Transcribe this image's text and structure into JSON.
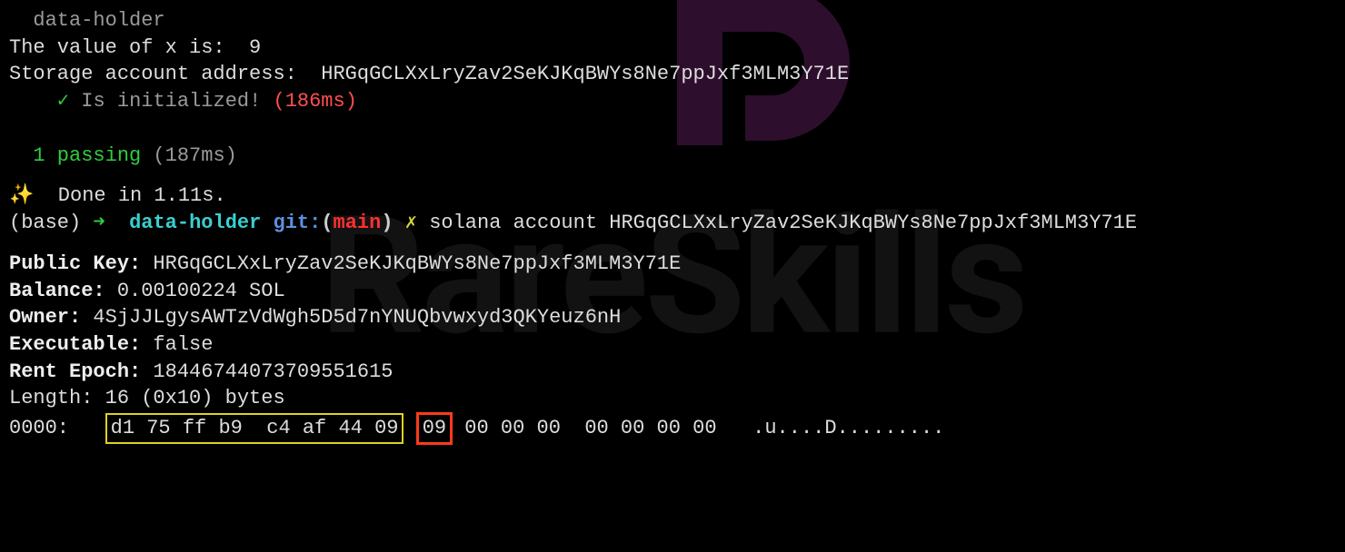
{
  "watermark": "RareSkills",
  "test": {
    "suite": "  data-holder",
    "line_x": "The value of x is:  9",
    "line_storage": "Storage account address:  HRGqGCLXxLryZav2SeKJKqBWYs8Ne7ppJxf3MLM3Y71E",
    "check": "    ✓ ",
    "is_init": "Is initialized! ",
    "timing": "(186ms)",
    "passing_count": "  1 passing",
    "passing_time": " (187ms)"
  },
  "done": {
    "sparkle": "✨",
    "text": "  Done in 1.11s."
  },
  "prompt": {
    "base": "(base) ",
    "arrow": "➜",
    "dir": "  data-holder",
    "git": " git:",
    "open": "(",
    "branch": "main",
    "close": ")",
    "cross": " ✗ ",
    "cmd": "solana account HRGqGCLXxLryZav2SeKJKqBWYs8Ne7ppJxf3MLM3Y71E"
  },
  "account": {
    "pubkey_label": "Public Key:",
    "pubkey_val": " HRGqGCLXxLryZav2SeKJKqBWYs8Ne7ppJxf3MLM3Y71E",
    "balance_label": "Balance:",
    "balance_val": " 0.00100224 SOL",
    "owner_label": "Owner:",
    "owner_val": " 4SjJJLgysAWTzVdWgh5D5d7nYNUQbvwxyd3QKYeuz6nH",
    "exec_label": "Executable:",
    "exec_val": " false",
    "rent_label": "Rent Epoch:",
    "rent_val": " 18446744073709551615",
    "length": "Length: 16 (0x10) bytes"
  },
  "hex": {
    "offset": "0000:",
    "gap1": "   ",
    "group1": "d1 75 ff b9  c4 af 44 09",
    "gap2": " ",
    "group2": "09",
    "gap3": " ",
    "rest": "00 00 00  00 00 00 00   .u....D........."
  }
}
